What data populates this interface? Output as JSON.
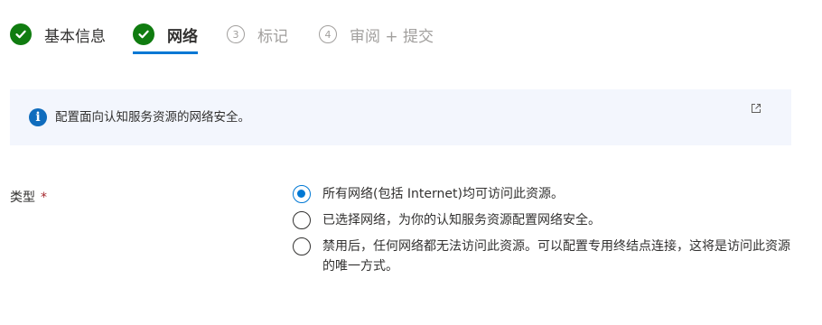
{
  "stepper": {
    "steps": [
      {
        "number": "",
        "label": "基本信息",
        "state": "done"
      },
      {
        "number": "",
        "label": "网络",
        "state": "active"
      },
      {
        "number": "3",
        "label": "标记",
        "state": "pending"
      },
      {
        "number": "4",
        "label": "审阅 + 提交",
        "state": "pending"
      }
    ]
  },
  "info": {
    "icon": "info-icon",
    "text": "配置面向认知服务资源的网络安全。",
    "link_icon": "external-link-icon"
  },
  "form": {
    "type_label": "类型",
    "required_mark": "*",
    "options": [
      {
        "label": "所有网络(包括 Internet)均可访问此资源。",
        "selected": true
      },
      {
        "label": "已选择网络，为你的认知服务资源配置网络安全。",
        "selected": false
      },
      {
        "label": "禁用后，任何网络都无法访问此资源。可以配置专用终结点连接，这将是访问此资源的唯一方式。",
        "selected": false
      }
    ]
  },
  "colors": {
    "accent": "#0078d4",
    "success": "#107c10",
    "info_background": "#f3f6fd",
    "required": "#a4262c"
  }
}
